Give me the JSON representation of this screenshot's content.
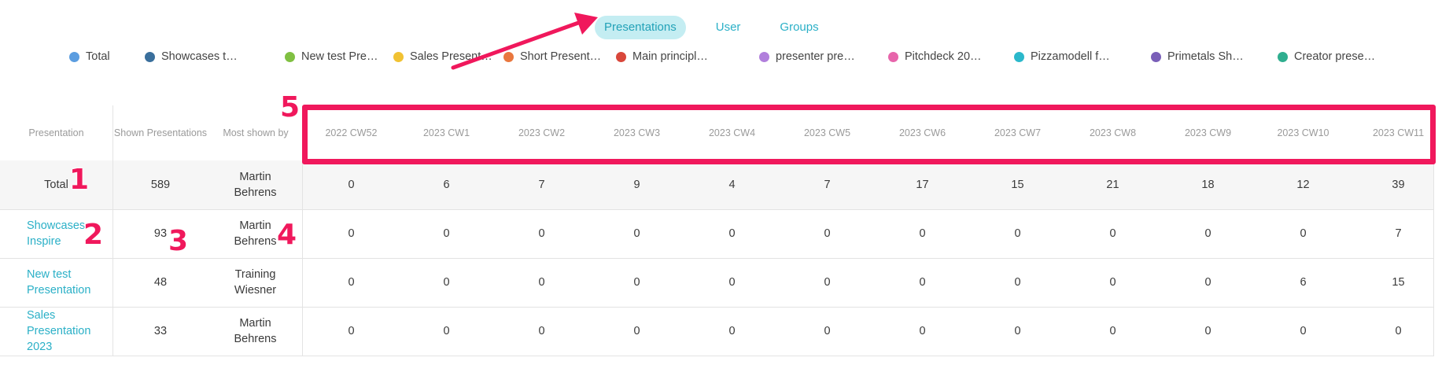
{
  "tabs": [
    {
      "label": "Presentations",
      "active": true
    },
    {
      "label": "User",
      "active": false
    },
    {
      "label": "Groups",
      "active": false
    }
  ],
  "legend": [
    {
      "label": "Total",
      "color": "#5b9de0"
    },
    {
      "label": "Showcases t…",
      "color": "#3a6f9c"
    },
    {
      "label": "New test Pre…",
      "color": "#80c042"
    },
    {
      "label": "Sales Present…",
      "color": "#f1c233"
    },
    {
      "label": "Short Present…",
      "color": "#e9773e"
    },
    {
      "label": "Main principl…",
      "color": "#d9473b"
    },
    {
      "label": "presenter pre…",
      "color": "#b17fdc"
    },
    {
      "label": "Pitchdeck 20…",
      "color": "#e765ab"
    },
    {
      "label": "Pizzamodell f…",
      "color": "#2bb8cb"
    },
    {
      "label": "Primetals Sh…",
      "color": "#7a5fb8"
    },
    {
      "label": "Creator prese…",
      "color": "#2fae8f"
    }
  ],
  "table": {
    "headers": {
      "presentation": "Presentation",
      "shown": "Shown Presentations",
      "most_shown_by": "Most shown by"
    },
    "weeks": [
      "2022 CW52",
      "2023 CW1",
      "2023 CW2",
      "2023 CW3",
      "2023 CW4",
      "2023 CW5",
      "2023 CW6",
      "2023 CW7",
      "2023 CW8",
      "2023 CW9",
      "2023 CW10",
      "2023 CW11"
    ],
    "rows": [
      {
        "name": "Total",
        "shown": "589",
        "most": "Martin Behrens",
        "values": [
          "0",
          "6",
          "7",
          "9",
          "4",
          "7",
          "17",
          "15",
          "21",
          "18",
          "12",
          "39"
        ]
      },
      {
        "name": "Showcases Inspire",
        "shown": "93",
        "most": "Martin Behrens",
        "values": [
          "0",
          "0",
          "0",
          "0",
          "0",
          "0",
          "0",
          "0",
          "0",
          "0",
          "0",
          "7"
        ]
      },
      {
        "name": "New test Presentation",
        "shown": "48",
        "most": "Training Wiesner",
        "values": [
          "0",
          "0",
          "0",
          "0",
          "0",
          "0",
          "0",
          "0",
          "0",
          "0",
          "6",
          "15"
        ]
      },
      {
        "name": "Sales Presentation 2023",
        "shown": "33",
        "most": "Martin Behrens",
        "values": [
          "0",
          "0",
          "0",
          "0",
          "0",
          "0",
          "0",
          "0",
          "0",
          "0",
          "0",
          "0"
        ]
      }
    ]
  },
  "annotations": {
    "n1": "1",
    "n2": "2",
    "n3": "3",
    "n4": "4",
    "n5": "5",
    "color": "#f0185c"
  }
}
